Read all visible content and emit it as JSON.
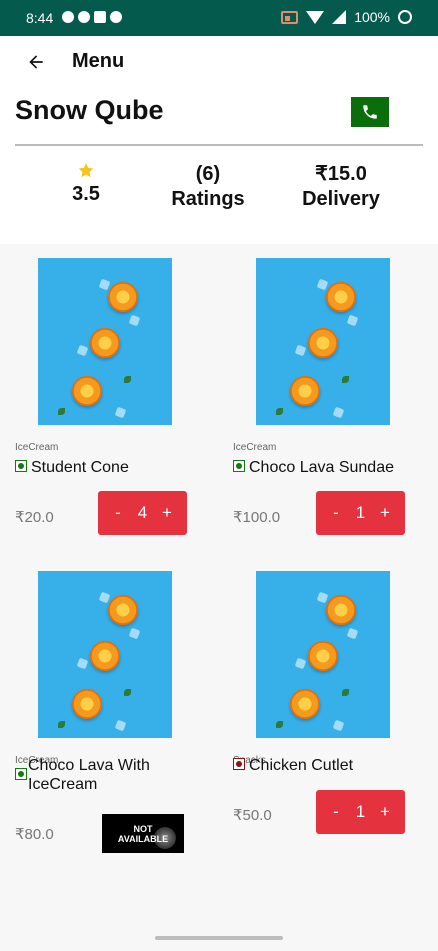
{
  "status_bar": {
    "time": "8:44",
    "battery": "100%"
  },
  "header": {
    "title": "Menu"
  },
  "restaurant": {
    "name": "Snow Qube",
    "rating": "3.5",
    "ratings_count": "(6)",
    "ratings_label": "Ratings",
    "delivery_fee": "₹15.0",
    "delivery_label": "Delivery"
  },
  "items": [
    {
      "category": "IceCream",
      "name": "Student Cone",
      "veg": true,
      "price": "₹20.0",
      "available": true,
      "quantity": "4"
    },
    {
      "category": "IceCream",
      "name": "Choco Lava Sundae",
      "veg": true,
      "price": "₹100.0",
      "available": true,
      "quantity": "1"
    },
    {
      "category": "IceCream",
      "name": "Choco Lava With IceCream",
      "veg": true,
      "price": "₹80.0",
      "available": false,
      "badge_line1": "NOT",
      "badge_line2": "AVAILABLE"
    },
    {
      "category": "Snacks",
      "name": "Chicken Cutlet",
      "veg": false,
      "price": "₹50.0",
      "available": true,
      "quantity": "1"
    }
  ],
  "stepper": {
    "minus_label": "-",
    "plus_label": "+"
  },
  "colors": {
    "status_bar": "#055a4e",
    "accent": "#e5323f",
    "call": "#0a6e0a",
    "star": "#f5c518",
    "image_bg": "#37b0ea"
  },
  "icons": {
    "back": "arrow-left-icon",
    "call": "phone-icon",
    "star": "star-icon"
  }
}
